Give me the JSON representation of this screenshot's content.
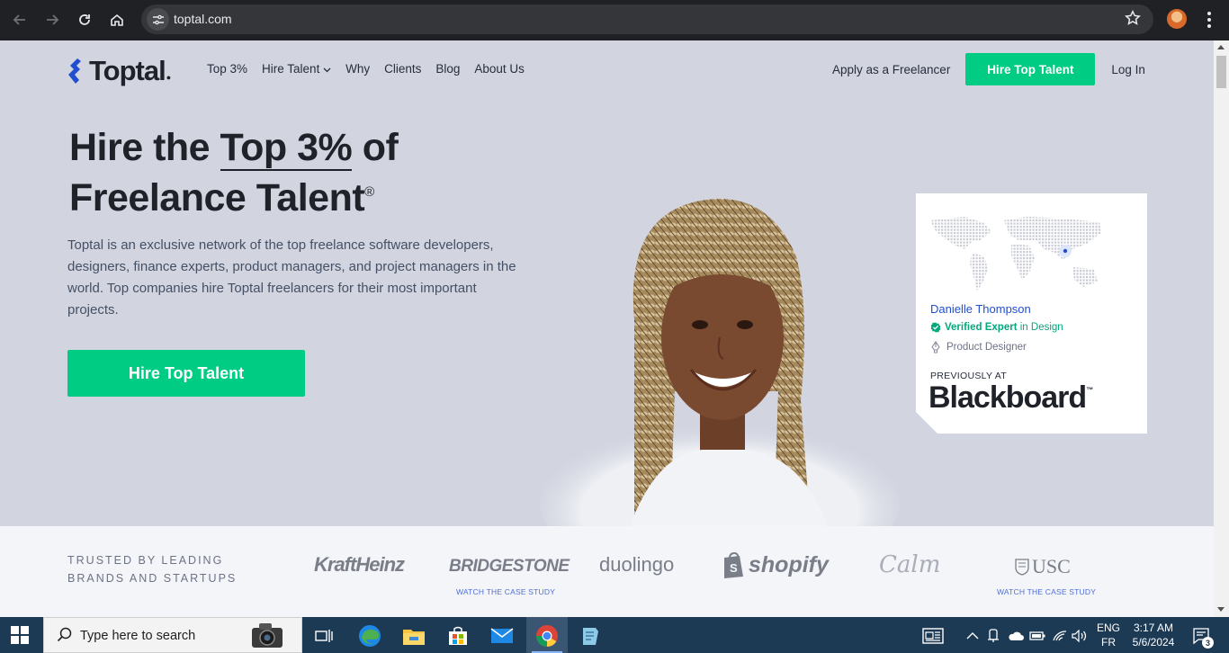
{
  "browser": {
    "url": "toptal.com"
  },
  "nav": {
    "logo": "Toptal",
    "items": [
      "Top 3%",
      "Hire Talent",
      "Why",
      "Clients",
      "Blog",
      "About Us"
    ],
    "apply": "Apply as a Freelancer",
    "hire_button": "Hire Top Talent",
    "login": "Log In"
  },
  "hero": {
    "headline_part1": "Hire the ",
    "headline_highlight": "Top 3%",
    "headline_part2": " of",
    "headline_line2": "Freelance Talent",
    "registered": "®",
    "description": "Toptal is an exclusive network of the top freelance software developers, designers, finance experts, product managers, and project managers in the world. Top companies hire Toptal freelancers for their most important projects.",
    "cta": "Hire Top Talent"
  },
  "profile_card": {
    "name": "Danielle Thompson",
    "verified_strong": "Verified Expert",
    "verified_rest": " in Design",
    "role": "Product Designer",
    "previously_label": "PREVIOUSLY AT",
    "previous_company": "Blackboard"
  },
  "trusted": {
    "line1": "TRUSTED BY LEADING",
    "line2": "BRANDS AND STARTUPS",
    "brands": [
      "KraftHeinz",
      "BRIDGESTONE",
      "duolingo",
      "shopify",
      "Calm",
      "USC"
    ],
    "case_study": "WATCH THE CASE STUDY"
  },
  "taskbar": {
    "search_placeholder": "Type here to search",
    "lang_top": "ENG",
    "lang_bottom": "FR",
    "time": "3:17 AM",
    "date": "5/6/2024",
    "notifications": "3"
  },
  "colors": {
    "accent_green": "#00cc83",
    "brand_blue": "#204ecf",
    "page_bg": "#d2d5e0"
  }
}
